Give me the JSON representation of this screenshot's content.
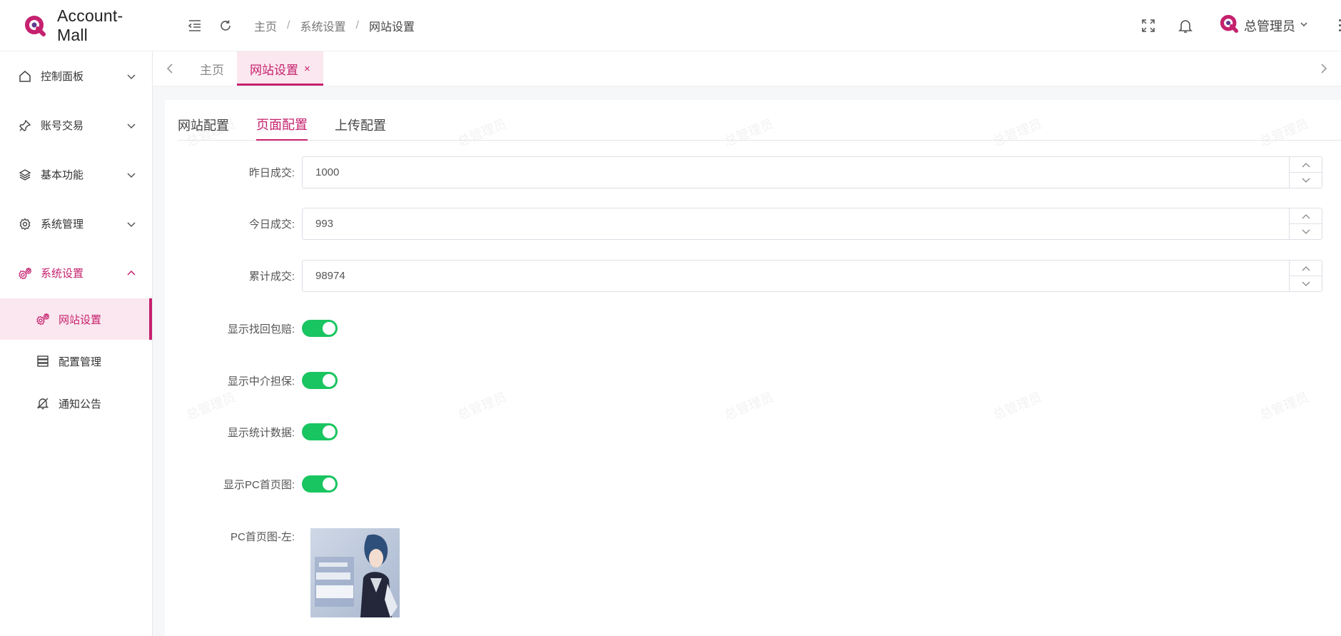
{
  "app": {
    "name": "Account-Mall"
  },
  "header": {
    "breadcrumb": [
      "主页",
      "系统设置",
      "网站设置"
    ],
    "user": {
      "name": "总管理员"
    }
  },
  "sidebar": {
    "items": [
      {
        "label": "控制面板",
        "icon": "home-icon"
      },
      {
        "label": "账号交易",
        "icon": "pin-icon"
      },
      {
        "label": "基本功能",
        "icon": "layers-icon"
      },
      {
        "label": "系统管理",
        "icon": "gear-icon"
      },
      {
        "label": "系统设置",
        "icon": "gears-icon",
        "expanded": true
      }
    ],
    "sub_items": [
      {
        "label": "网站设置",
        "icon": "gears-icon",
        "active": true
      },
      {
        "label": "配置管理",
        "icon": "database-icon"
      },
      {
        "label": "通知公告",
        "icon": "bell-off-icon"
      }
    ]
  },
  "page_tabs": [
    {
      "label": "主页"
    },
    {
      "label": "网站设置",
      "active": true,
      "close": "×"
    }
  ],
  "section_tabs": [
    {
      "label": "网站配置"
    },
    {
      "label": "页面配置",
      "active": true
    },
    {
      "label": "上传配置"
    }
  ],
  "form": {
    "yesterday": {
      "label": "昨日成交:",
      "value": "1000"
    },
    "today": {
      "label": "今日成交:",
      "value": "993"
    },
    "total": {
      "label": "累计成交:",
      "value": "98974"
    },
    "switches": [
      {
        "label": "显示找回包赔:",
        "on": true
      },
      {
        "label": "显示中介担保:",
        "on": true
      },
      {
        "label": "显示统计数据:",
        "on": true
      },
      {
        "label": "显示PC首页图:",
        "on": true
      }
    ],
    "pc_image_left": {
      "label": "PC首页图-左:"
    }
  },
  "watermark": "总管理员",
  "colors": {
    "accent": "#c5216e",
    "switch_on": "#19c560",
    "active_bg": "#fbe7ef"
  }
}
